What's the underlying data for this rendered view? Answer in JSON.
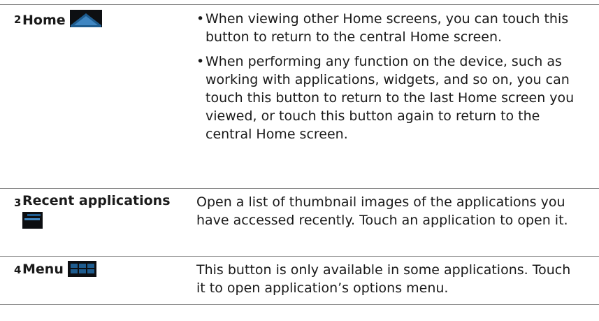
{
  "rows": [
    {
      "number": "2",
      "name": "Home",
      "icon": "home-icon",
      "bullets": [
        "When viewing other Home screens, you can touch this button to return to the central Home screen.",
        "When performing any function on the device, such as working with applications, widgets, and so on, you can touch this button to return to the last Home screen you viewed, or touch this button again to return to the central Home screen."
      ]
    },
    {
      "number": "3",
      "name": "Recent applications",
      "icon": "recent-apps-icon",
      "description": "Open a list of thumbnail images of the applications you have accessed recently. Touch an application to open it."
    },
    {
      "number": "4",
      "name": "Menu",
      "icon": "menu-icon",
      "description": "This button is only available in some applications. Touch it to open application’s options menu."
    }
  ],
  "colors": {
    "rule": "#8a8a8a",
    "icon_bg": "#0d0f12",
    "icon_accent": "#1e5c8f",
    "text": "#1a1a1a"
  }
}
